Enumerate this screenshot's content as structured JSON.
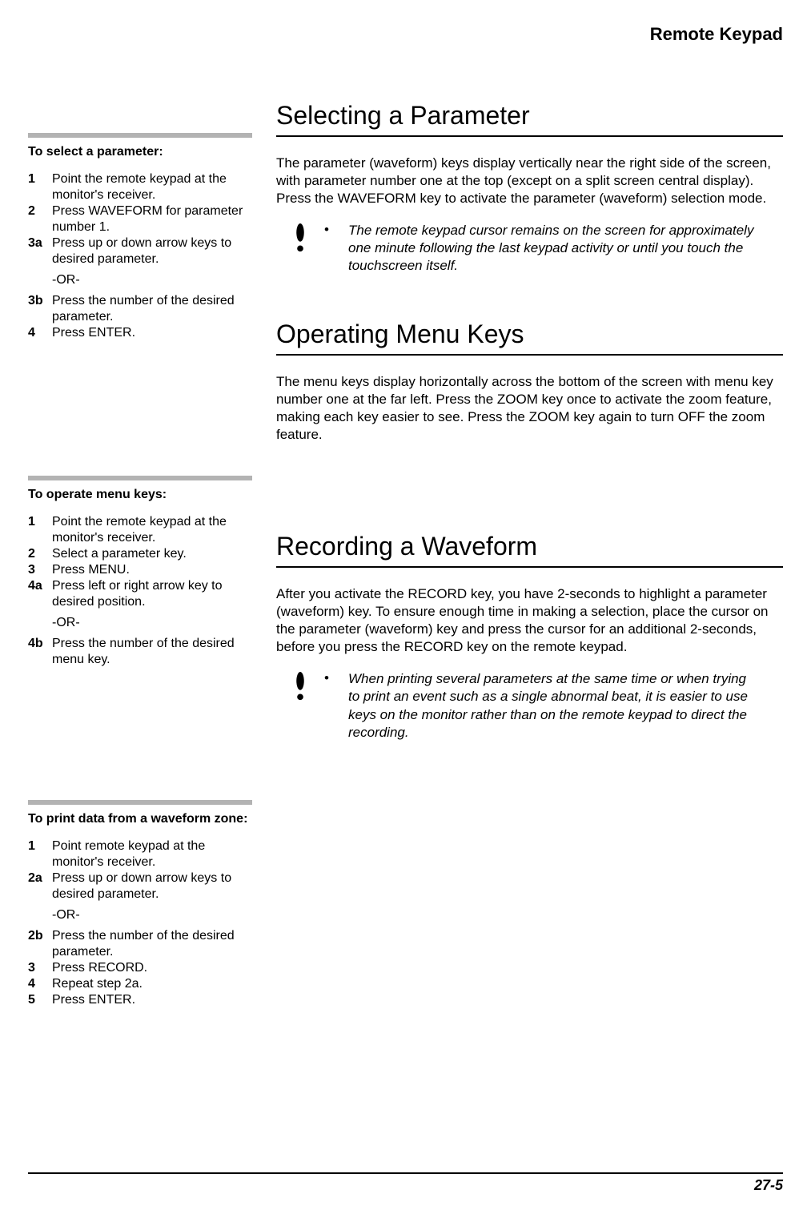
{
  "header": {
    "running_title": "Remote Keypad"
  },
  "sidebar": {
    "blocks": [
      {
        "heading": "To select a parameter:",
        "items": [
          {
            "num": "1",
            "text": "Point the remote keypad at the monitor's receiver."
          },
          {
            "num": "2",
            "text": "Press WAVEFORM for parameter number 1."
          },
          {
            "num": "3a",
            "text": "Press up or down arrow keys to desired parameter."
          },
          {
            "or": "-OR-"
          },
          {
            "num": "3b",
            "text": "Press the number of the desired parameter."
          },
          {
            "num": "4",
            "text": "Press ENTER."
          }
        ]
      },
      {
        "heading": "To operate menu keys:",
        "items": [
          {
            "num": "1",
            "text": "Point the remote keypad at the monitor's receiver."
          },
          {
            "num": "2",
            "text": "Select a parameter key."
          },
          {
            "num": "3",
            "text": "Press MENU."
          },
          {
            "num": "4a",
            "text": "Press left or right arrow key to desired position."
          },
          {
            "or": "-OR-"
          },
          {
            "num": "4b",
            "text": "Press the number of the desired menu key."
          }
        ]
      },
      {
        "heading": "To print data from a waveform zone:",
        "items": [
          {
            "num": "1",
            "text": "Point remote keypad at the monitor's receiver."
          },
          {
            "num": "2a",
            "text": "Press up or down arrow keys to desired parameter."
          },
          {
            "or": "-OR-"
          },
          {
            "num": "2b",
            "text": "Press the number of the desired parameter."
          },
          {
            "num": "3",
            "text": "Press RECORD."
          },
          {
            "num": "4",
            "text": "Repeat step 2a."
          },
          {
            "num": "5",
            "text": "Press ENTER."
          }
        ]
      }
    ]
  },
  "main": {
    "sections": [
      {
        "title": "Selecting a Parameter",
        "body": "The parameter (waveform) keys display vertically near the right side of the screen, with parameter number one at the top (except on a split screen central display). Press the WAVEFORM key to activate the parameter (waveform) selection mode.",
        "note": "The remote keypad cursor remains on the screen for approximately one minute following the last keypad activity or until you touch the touchscreen itself."
      },
      {
        "title": "Operating Menu Keys",
        "body": "The menu keys display horizontally across the bottom of the screen with menu key number one at the far left. Press the ZOOM key once to activate the zoom feature, making each key easier to see. Press the ZOOM key again to turn OFF the zoom feature."
      },
      {
        "title": "Recording a Waveform",
        "body": "After you activate the RECORD key, you have 2-seconds to highlight a parameter (waveform) key. To ensure enough time in making a selection, place the cursor on the parameter (waveform) key and press the cursor for an additional 2-seconds, before you press the RECORD key on the remote keypad.",
        "note": "When printing several parameters at the same time or when trying to print an event such as a single abnormal beat, it is easier to use keys on the monitor rather than on the remote keypad to direct the recording."
      }
    ]
  },
  "footer": {
    "page_number": "27-5"
  },
  "glyphs": {
    "bullet": "•"
  }
}
